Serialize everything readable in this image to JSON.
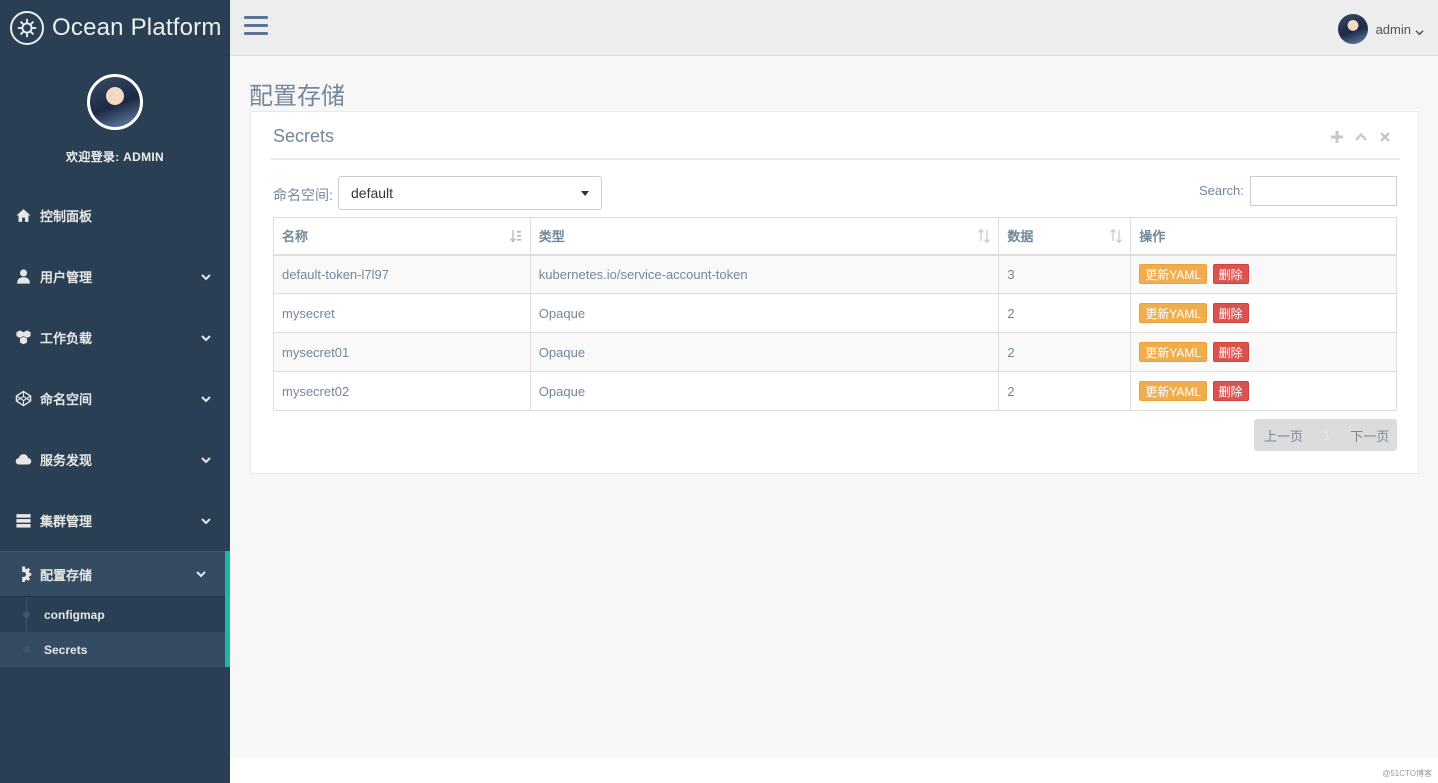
{
  "brand": {
    "title": "Ocean Platform",
    "icon": "helm-icon"
  },
  "profile": {
    "welcome": "欢迎登录: ADMIN"
  },
  "sidebar": {
    "items": [
      {
        "label": "控制面板",
        "icon": "home-icon"
      },
      {
        "label": "用户管理",
        "icon": "user-icon"
      },
      {
        "label": "工作负载",
        "icon": "cubes-icon"
      },
      {
        "label": "命名空间",
        "icon": "codepen-icon"
      },
      {
        "label": "服务发现",
        "icon": "cloud-icon"
      },
      {
        "label": "集群管理",
        "icon": "server-icon"
      },
      {
        "label": "配置存储",
        "icon": "gear-icon",
        "active": true
      }
    ],
    "submenu": [
      {
        "label": "configmap"
      },
      {
        "label": "Secrets",
        "current": true
      }
    ]
  },
  "topnav": {
    "username": "admin"
  },
  "page": {
    "title": "配置存储"
  },
  "panel": {
    "title": "Secrets",
    "namespace_label": "命名空间:",
    "namespace_value": "default",
    "search_label": "Search:",
    "search_value": ""
  },
  "table": {
    "headers": [
      "名称",
      "类型",
      "数据",
      "操作"
    ],
    "rows": [
      {
        "name": "default-token-l7l97",
        "type": "kubernetes.io/service-account-token",
        "data": "3"
      },
      {
        "name": "mysecret",
        "type": "Opaque",
        "data": "2"
      },
      {
        "name": "mysecret01",
        "type": "Opaque",
        "data": "2"
      },
      {
        "name": "mysecret02",
        "type": "Opaque",
        "data": "2"
      }
    ],
    "update_label": "更新YAML",
    "delete_label": "删除"
  },
  "pagination": {
    "prev": "上一页",
    "current": "1",
    "next": "下一页"
  },
  "watermark": "@51CTO博客",
  "colors": {
    "sidebar_bg": "#2a3f54",
    "accent": "#1abb9c",
    "warning": "#f0ad4e",
    "danger": "#d9534f"
  }
}
